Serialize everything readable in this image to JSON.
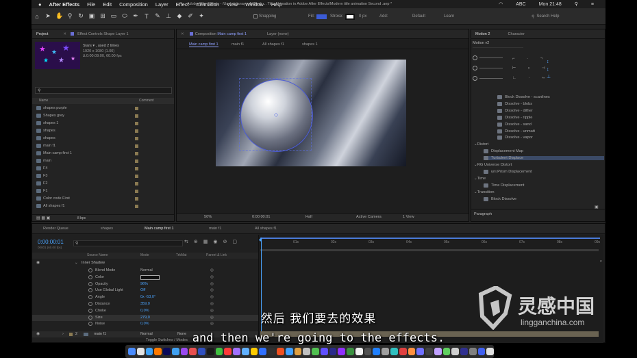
{
  "menubar": {
    "app": "After Effects",
    "items": [
      "File",
      "Edit",
      "Composition",
      "Layer",
      "Effect",
      "Animation",
      "View",
      "Window",
      "Help"
    ],
    "abc": "ABC",
    "clock": "Mon 21:48"
  },
  "toolbar": {
    "path": "Adobe After Effects - /Users/alanayoubi/Desk ... Title Animation in Adobe After Effects/Modern title animation Second .aep *",
    "snapping": "Snapping",
    "fill": "Fill:",
    "stroke": "Stroke:",
    "stroke_px": "0 px",
    "add": "Add:",
    "workspaces": [
      "Default",
      "Learn"
    ],
    "search": "Search Help"
  },
  "project": {
    "tab": "Project",
    "effect_controls": "Effect Controls Shape Layer 1",
    "item_name": "Stars",
    "item_used": ", used 2 times",
    "item_res": "1920 x 1080 (1.00)",
    "item_dur": "Δ 0:00:09:00, 60.00 fps",
    "col_name": "Name",
    "col_comment": "Comment",
    "bpc": "8 bpc",
    "items": [
      "shapes purple",
      "Shapes grey",
      "shapes 1",
      "shapes",
      "shapes",
      "main f1",
      "Main camp first 1",
      "main",
      "F4",
      "F3",
      "F2",
      "F1",
      "Color code First",
      "All shapes f1"
    ]
  },
  "comp": {
    "tab": "Composition",
    "comp_name": "Main camp first 1",
    "layer_tab": "Layer (none)",
    "subtabs": [
      "Main camp first 1",
      "main f1",
      "All shapes f1",
      "shapes 1"
    ],
    "zoom": "50%",
    "timecode": "0:00:00:01",
    "res": "Half",
    "camera": "Active Camera",
    "view": "1 View"
  },
  "motion": {
    "tab": "Motion 2",
    "character": "Character",
    "version": "Motion v2",
    "paragraph": "Paragraph"
  },
  "effects": [
    {
      "t": "Block Dissolve - scanlines",
      "i": 1
    },
    {
      "t": "Dissolve - blobs",
      "i": 1
    },
    {
      "t": "Dissolve - dither",
      "i": 1
    },
    {
      "t": "Dissolve - ripple",
      "i": 1
    },
    {
      "t": "Dissolve - sand",
      "i": 1
    },
    {
      "t": "Dissolve - unmatt",
      "i": 1
    },
    {
      "t": "Dissolve - vapor",
      "i": 1
    },
    {
      "t": "Distort",
      "i": 0
    },
    {
      "t": "Displacement Map",
      "i": 1
    },
    {
      "t": "Turbulent Displace",
      "i": 1
    },
    {
      "t": "RG Universe Distort",
      "i": 0
    },
    {
      "t": "uni.Prism Displacement",
      "i": 1
    },
    {
      "t": "Time",
      "i": 0
    },
    {
      "t": "Time Displacement",
      "i": 1
    },
    {
      "t": "Transition",
      "i": 0
    },
    {
      "t": "Block Dissolve",
      "i": 1
    }
  ],
  "timeline": {
    "tabs": [
      "Render Queue",
      "shapes",
      "Main camp first 1",
      "main f1",
      "All shapes f1"
    ],
    "timecode": "0:00:00:01",
    "fps": "00001 (60.00 fps)",
    "col_source": "Source Name",
    "col_mode": "Mode",
    "col_trkmat": "TrkMat",
    "col_parent": "Parent & Link",
    "group": "Inner Shadow",
    "props": [
      {
        "n": "Blend Mode",
        "v": "Normal"
      },
      {
        "n": "Color",
        "v": ""
      },
      {
        "n": "Opacity",
        "v": "96%"
      },
      {
        "n": "Use Global Light",
        "v": "Off"
      },
      {
        "n": "Angle",
        "v": "0x -53,0°"
      },
      {
        "n": "Distance",
        "v": "359,0"
      },
      {
        "n": "Choke",
        "v": "0,0%"
      },
      {
        "n": "Size",
        "v": "279,0"
      },
      {
        "n": "Noise",
        "v": "0,0%"
      }
    ],
    "layer_num": "2",
    "layer_name": "main f1",
    "layer_mode": "Normal",
    "layer_trk": "None",
    "switch": "Toggle Switches / Modes",
    "ruler": [
      "01s",
      "02s",
      "03s",
      "04s",
      "05s",
      "06s",
      "07s",
      "08s",
      "09s"
    ]
  },
  "subtitles": {
    "zh": "然后 我们要去的效果",
    "en": "and then we're going to the effects."
  },
  "watermark": {
    "brand": "灵感中国",
    "url": "lingganchina.com"
  }
}
